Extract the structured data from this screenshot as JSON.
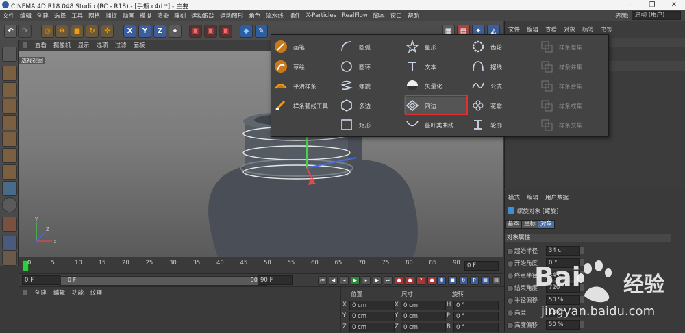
{
  "window": {
    "title": "CINEMA 4D R18.048 Studio (RC - R18) - [手瓶.c4d *] - 主要",
    "controls": [
      "–",
      "❐",
      "✕"
    ]
  },
  "menu": {
    "items": [
      "文件",
      "编辑",
      "创建",
      "选择",
      "工具",
      "网格",
      "捕捉",
      "动画",
      "模拟",
      "渲染",
      "雕刻",
      "运动跟踪",
      "运动图形",
      "角色",
      "流水线",
      "插件",
      "X-Particles",
      "RealFlow",
      "脚本",
      "窗口",
      "帮助"
    ],
    "layout_label": "界面:",
    "layout_value": "启动 (用户)"
  },
  "viewport": {
    "menu": [
      "查看",
      "摄像机",
      "显示",
      "选项",
      "过滤",
      "面板"
    ],
    "label": "透视视图",
    "axis_labels": [
      "Y",
      "X",
      "Z"
    ]
  },
  "spline_popup": {
    "columns": [
      [
        {
          "label": "画笔",
          "icon": "pen-icon"
        },
        {
          "label": "草绘",
          "icon": "sketch-icon"
        },
        {
          "label": "平滑样条",
          "icon": "smooth-spline-icon"
        },
        {
          "label": "样条弧线工具",
          "icon": "arc-tool-icon"
        }
      ],
      [
        {
          "label": "圆弧",
          "icon": "arc-icon"
        },
        {
          "label": "圆环",
          "icon": "circle-icon"
        },
        {
          "label": "螺旋",
          "icon": "helix-icon"
        },
        {
          "label": "多边",
          "icon": "hexagon-icon"
        },
        {
          "label": "矩形",
          "icon": "rectangle-icon"
        }
      ],
      [
        {
          "label": "星形",
          "icon": "star-icon"
        },
        {
          "label": "文本",
          "icon": "text-icon"
        },
        {
          "label": "矢量化",
          "icon": "vectorize-icon"
        },
        {
          "label": "四边",
          "icon": "diamond-icon"
        },
        {
          "label": "蔓叶类曲线",
          "icon": "cissoid-icon"
        }
      ],
      [
        {
          "label": "齿轮",
          "icon": "gear-icon"
        },
        {
          "label": "摆线",
          "icon": "cycloid-icon"
        },
        {
          "label": "公式",
          "icon": "formula-icon"
        },
        {
          "label": "花瓣",
          "icon": "flower-icon"
        },
        {
          "label": "轮廓",
          "icon": "profile-icon"
        }
      ],
      [
        {
          "label": "样条差集",
          "icon": "spline-subtract-icon"
        },
        {
          "label": "样条并集",
          "icon": "spline-union-icon"
        },
        {
          "label": "样条合集",
          "icon": "spline-and-icon"
        },
        {
          "label": "样条或集",
          "icon": "spline-or-icon"
        },
        {
          "label": "样条交集",
          "icon": "spline-intersect-icon"
        }
      ]
    ],
    "selected": "四边"
  },
  "timeline": {
    "ticks": [
      "0",
      "5",
      "10",
      "15",
      "20",
      "25",
      "30",
      "35",
      "40",
      "45",
      "50",
      "55",
      "60",
      "65",
      "70",
      "75",
      "80",
      "85",
      "90"
    ],
    "current_frame": "0 F"
  },
  "transport": {
    "start": "0 F",
    "range_start": "0 F",
    "range_end": "90 F",
    "end": "90 F"
  },
  "material_panel": {
    "menu": [
      "创建",
      "编辑",
      "功能",
      "纹理"
    ]
  },
  "coords": {
    "headers": [
      "位置",
      "尺寸",
      "旋转"
    ],
    "rows": [
      {
        "axis": "X",
        "pos": "0 cm",
        "size": "0 cm",
        "rot_axis": "H",
        "rot": "0 °"
      },
      {
        "axis": "Y",
        "pos": "0 cm",
        "size": "0 cm",
        "rot_axis": "P",
        "rot": "0 °"
      },
      {
        "axis": "Z",
        "pos": "0 cm",
        "size": "0 cm",
        "rot_axis": "B",
        "rot": "0 °"
      }
    ]
  },
  "object_manager": {
    "menu": [
      "文件",
      "编辑",
      "查看",
      "对象",
      "标签",
      "书签"
    ]
  },
  "attributes": {
    "menu": [
      "模式",
      "编辑",
      "用户数据"
    ],
    "object_title": "螺旋对象 [螺旋]",
    "tabs": [
      "基本",
      "坐标",
      "对象"
    ],
    "active_tab": "对象",
    "section": "对象属性",
    "props": [
      {
        "label": "起始半径",
        "value": "34 cm"
      },
      {
        "label": "开始角度",
        "value": "0 °"
      },
      {
        "label": "终点半径",
        "value": "34 cm"
      },
      {
        "label": "结束角度",
        "value": "720 °"
      },
      {
        "label": "半径偏移",
        "value": "50 %"
      },
      {
        "label": "高度",
        "value": "13 cm"
      },
      {
        "label": "高度偏移",
        "value": "50 %"
      }
    ]
  },
  "watermark": {
    "brand": "Bai",
    "brand_cn": "经验",
    "url": "jingyan.baidu.com"
  },
  "colors": {
    "accent_blue": "#4a90d9",
    "highlight_red": "#e03030",
    "selected_tab": "#4a6fa5"
  }
}
